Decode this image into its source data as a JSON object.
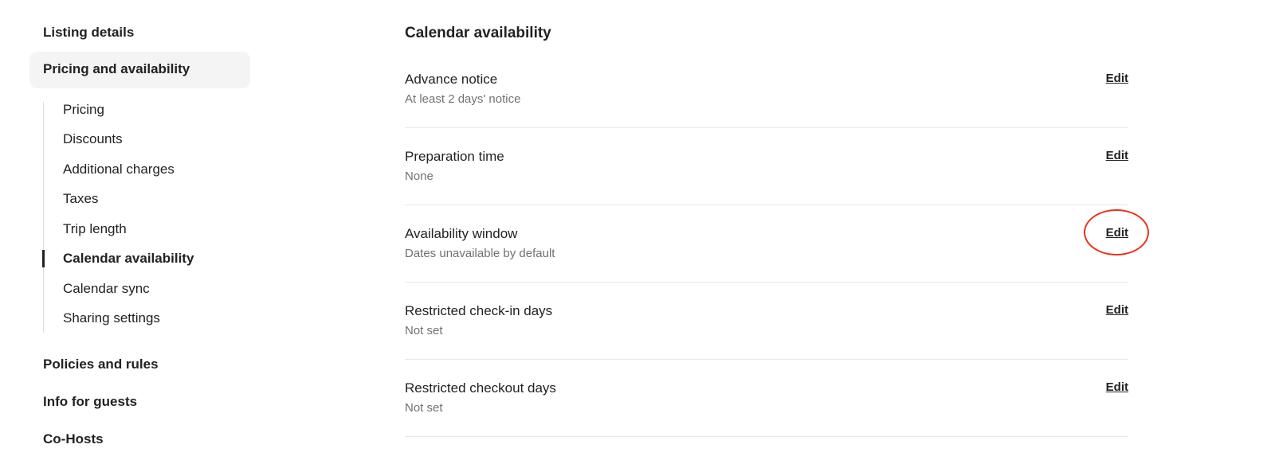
{
  "sidebar": {
    "top_items": [
      {
        "label": "Listing details"
      },
      {
        "label": "Pricing and availability",
        "active": true
      },
      {
        "label": "Policies and rules"
      },
      {
        "label": "Info for guests"
      },
      {
        "label": "Co-Hosts"
      }
    ],
    "sub_items": [
      {
        "label": "Pricing"
      },
      {
        "label": "Discounts"
      },
      {
        "label": "Additional charges"
      },
      {
        "label": "Taxes"
      },
      {
        "label": "Trip length"
      },
      {
        "label": "Calendar availability",
        "active": true
      },
      {
        "label": "Calendar sync"
      },
      {
        "label": "Sharing settings"
      }
    ]
  },
  "main": {
    "title": "Calendar availability",
    "edit_label": "Edit",
    "rows": [
      {
        "label": "Advance notice",
        "value": "At least 2 days' notice"
      },
      {
        "label": "Preparation time",
        "value": "None"
      },
      {
        "label": "Availability window",
        "value": "Dates unavailable by default",
        "highlighted": true
      },
      {
        "label": "Restricted check-in days",
        "value": "Not set"
      },
      {
        "label": "Restricted checkout days",
        "value": "Not set"
      }
    ]
  },
  "colors": {
    "highlight": "#e8321e",
    "active_bg": "#f4f4f4",
    "secondary_text": "#717171"
  }
}
